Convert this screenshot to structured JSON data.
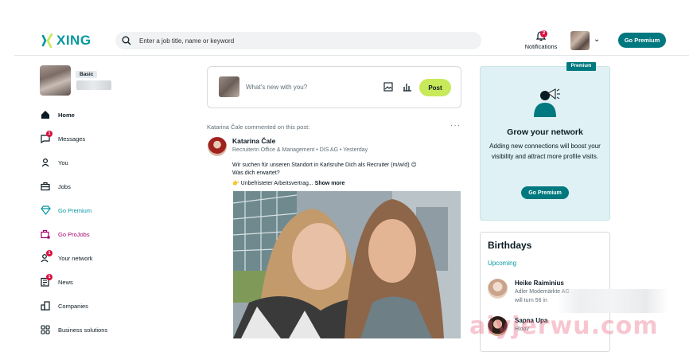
{
  "brand": {
    "logo_text": "XING",
    "brand_color": "#0698a0",
    "premium_color": "#00787f"
  },
  "header": {
    "search_placeholder": "Enter a job title, name or keyword",
    "notifications_label": "Notifications",
    "notifications_count": "2",
    "go_premium_label": "Go Premium"
  },
  "profile": {
    "badge": "Basic"
  },
  "sidebar": {
    "items": [
      {
        "label": "Home",
        "icon": "home-icon"
      },
      {
        "label": "Messages",
        "icon": "messages-icon",
        "badge": "1"
      },
      {
        "label": "You",
        "icon": "user-icon"
      },
      {
        "label": "Jobs",
        "icon": "briefcase-icon"
      },
      {
        "label": "Go Premium",
        "icon": "diamond-icon"
      },
      {
        "label": "Go ProJobs",
        "icon": "projobs-icon"
      },
      {
        "label": "Your network",
        "icon": "network-icon",
        "badge": "1"
      },
      {
        "label": "News",
        "icon": "news-icon",
        "badge": "1"
      },
      {
        "label": "Companies",
        "icon": "companies-icon"
      },
      {
        "label": "Business solutions",
        "icon": "business-icon"
      }
    ]
  },
  "composer": {
    "placeholder": "What's new with you?",
    "post_label": "Post"
  },
  "feed": {
    "activity_text": "Katarina Čale commented on this post:",
    "author_name": "Katarina Čale",
    "author_meta": "Recruiterin Office & Management • DIS AG • Yesterday",
    "line1": "Wir suchen für unseren Standort in Karlsruhe Dich als Recruiter (m/w/d) 😉",
    "line2": "Was dich erwartet?",
    "line3": "👉 Unbefristeter Arbeitsvertrag...",
    "show_more": "Show more"
  },
  "premium_card": {
    "tag": "Premium",
    "title": "Grow your network",
    "description": "Adding new connections will boost your visibility and attract more profile visits.",
    "button": "Go Premium"
  },
  "birthdays": {
    "title": "Birthdays",
    "subtitle": "Upcoming",
    "people": [
      {
        "name": "Heike Raiminius",
        "company": "Adler Modemärkte AG",
        "note": "will turn 56 in"
      },
      {
        "name": "Sapna Upa",
        "company": "Hloov",
        "note": ""
      }
    ]
  },
  "watermark": "aiyjerwu.com"
}
